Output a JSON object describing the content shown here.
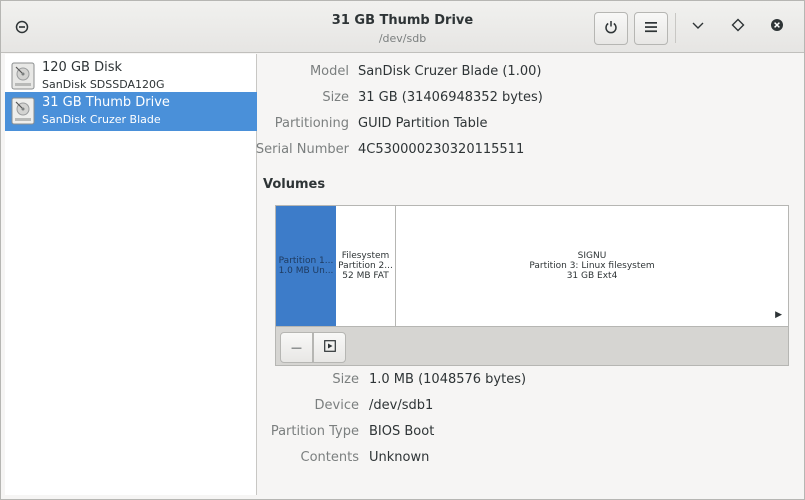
{
  "header": {
    "title": "31 GB Thumb Drive",
    "subtitle": "/dev/sdb"
  },
  "sidebar": {
    "disks": [
      {
        "name": "120 GB Disk",
        "model": "SanDisk SDSSDA120G",
        "selected": false
      },
      {
        "name": "31 GB Thumb Drive",
        "model": "SanDisk Cruzer Blade",
        "selected": true
      }
    ]
  },
  "drive": {
    "model_label": "Model",
    "model_value": "SanDisk Cruzer Blade (1.00)",
    "size_label": "Size",
    "size_value": "31 GB (31406948352 bytes)",
    "partitioning_label": "Partitioning",
    "partitioning_value": "GUID Partition Table",
    "serial_label": "Serial Number",
    "serial_value": "4C530000230320115511"
  },
  "volumes": {
    "title": "Volumes",
    "partitions": [
      {
        "line1": "Partition 1...",
        "line2": "1.0 MB Un...",
        "line3": ""
      },
      {
        "line1": "Filesystem",
        "line2": "Partition 2...",
        "line3": "52 MB FAT"
      },
      {
        "line1": "SIGNU",
        "line2": "Partition 3: Linux filesystem",
        "line3": "31 GB Ext4"
      }
    ],
    "remove_glyph": "—"
  },
  "selected_partition": {
    "size_label": "Size",
    "size_value": "1.0 MB (1048576 bytes)",
    "device_label": "Device",
    "device_value": "/dev/sdb1",
    "type_label": "Partition Type",
    "type_value": "BIOS Boot",
    "contents_label": "Contents",
    "contents_value": "Unknown"
  },
  "colors": {
    "selection": "#4a90d9",
    "partition_selected": "#3d7cc9"
  }
}
